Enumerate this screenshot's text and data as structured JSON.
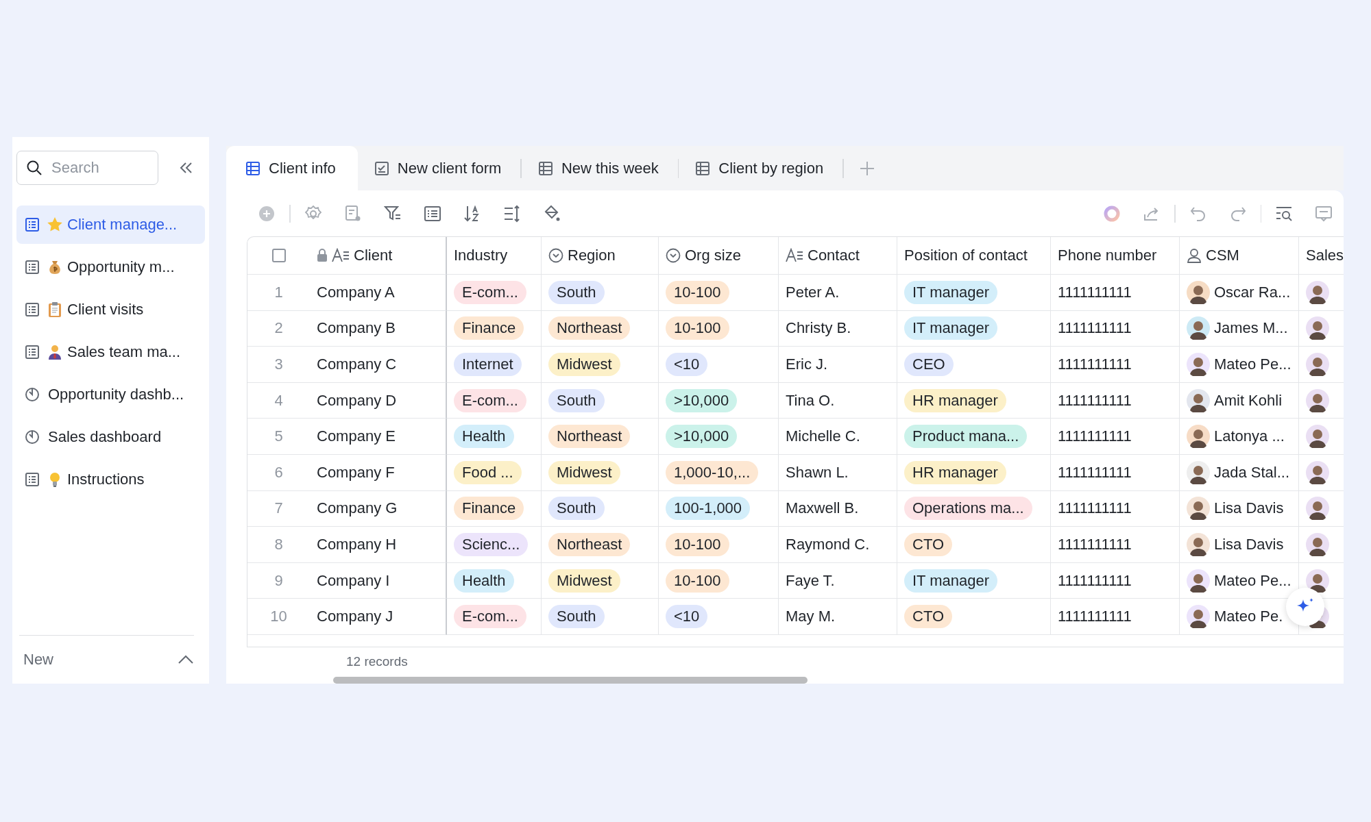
{
  "sidebar": {
    "search": {
      "placeholder": "Search"
    },
    "items": [
      {
        "label": "Client manage...",
        "kind": "table",
        "selected": true
      },
      {
        "label": "Opportunity m...",
        "kind": "table",
        "selected": false
      },
      {
        "label": "Client visits",
        "kind": "table",
        "selected": false
      },
      {
        "label": "Sales team ma...",
        "kind": "table",
        "selected": false
      },
      {
        "label": "Opportunity dashb...",
        "kind": "dashboard",
        "selected": false
      },
      {
        "label": "Sales dashboard",
        "kind": "dashboard",
        "selected": false
      },
      {
        "label": "Instructions",
        "kind": "table",
        "selected": false
      }
    ],
    "footer": {
      "label": "New",
      "expanded": true
    }
  },
  "tabs": [
    {
      "label": "Client info",
      "kind": "grid",
      "selected": true
    },
    {
      "label": "New client form",
      "kind": "form",
      "selected": false
    },
    {
      "label": "New this week",
      "kind": "grid",
      "selected": false
    },
    {
      "label": "Client by region",
      "kind": "grid",
      "selected": false
    }
  ],
  "table": {
    "select_all": {
      "checked": false
    },
    "columns": [
      {
        "label": "Client",
        "kind": "text",
        "locked": true
      },
      {
        "label": "Industry",
        "kind": "plain",
        "locked": false
      },
      {
        "label": "Region",
        "kind": "select",
        "locked": false
      },
      {
        "label": "Org size",
        "kind": "select",
        "locked": false
      },
      {
        "label": "Contact",
        "kind": "text",
        "locked": false
      },
      {
        "label": "Position of contact",
        "kind": "plain",
        "locked": false
      },
      {
        "label": "Phone number",
        "kind": "plain",
        "locked": false
      },
      {
        "label": "CSM",
        "kind": "person",
        "locked": false
      },
      {
        "label": "Sales",
        "kind": "plain",
        "locked": false
      }
    ],
    "rows": [
      {
        "number": "1",
        "client": "Company A",
        "industry": {
          "text": "E-com...",
          "color": "#fde3e6"
        },
        "region": {
          "text": "South",
          "color": "#e0e7fc"
        },
        "org_size": {
          "text": "10-100",
          "color": "#fde7d2"
        },
        "contact": "Peter A.",
        "position": {
          "text": "IT manager",
          "color": "#d3eefa"
        },
        "phone": "1111111111",
        "csm": "Oscar Ra...",
        "sales_avatar": true
      },
      {
        "number": "2",
        "client": "Company B",
        "industry": {
          "text": "Finance",
          "color": "#fde7d2"
        },
        "region": {
          "text": "Northeast",
          "color": "#fde7d2"
        },
        "org_size": {
          "text": "10-100",
          "color": "#fde7d2"
        },
        "contact": "Christy B.",
        "position": {
          "text": "IT manager",
          "color": "#d3eefa"
        },
        "phone": "1111111111",
        "csm": "James M...",
        "sales_avatar": true
      },
      {
        "number": "3",
        "client": "Company C",
        "industry": {
          "text": "Internet",
          "color": "#e0e7fc"
        },
        "region": {
          "text": "Midwest",
          "color": "#fcf0c8"
        },
        "org_size": {
          "text": "<10",
          "color": "#e0e7fc"
        },
        "contact": "Eric J.",
        "position": {
          "text": "CEO",
          "color": "#e0e7fc"
        },
        "phone": "1111111111",
        "csm": "Mateo Pe...",
        "sales_avatar": true
      },
      {
        "number": "4",
        "client": "Company D",
        "industry": {
          "text": "E-com...",
          "color": "#fde3e6"
        },
        "region": {
          "text": "South",
          "color": "#e0e7fc"
        },
        "org_size": {
          "text": ">10,000",
          "color": "#cbf2ea"
        },
        "contact": "Tina O.",
        "position": {
          "text": "HR manager",
          "color": "#fcf0c8"
        },
        "phone": "1111111111",
        "csm": "Amit Kohli",
        "sales_avatar": true
      },
      {
        "number": "5",
        "client": "Company E",
        "industry": {
          "text": "Health",
          "color": "#d3eefa"
        },
        "region": {
          "text": "Northeast",
          "color": "#fde7d2"
        },
        "org_size": {
          "text": ">10,000",
          "color": "#cbf2ea"
        },
        "contact": "Michelle C.",
        "position": {
          "text": "Product mana...",
          "color": "#cbf2ea"
        },
        "phone": "1111111111",
        "csm": "Latonya ...",
        "sales_avatar": true
      },
      {
        "number": "6",
        "client": "Company F",
        "industry": {
          "text": "Food ...",
          "color": "#fcf0c8"
        },
        "region": {
          "text": "Midwest",
          "color": "#fcf0c8"
        },
        "org_size": {
          "text": "1,000-10,...",
          "color": "#fde7d2"
        },
        "contact": "Shawn L.",
        "position": {
          "text": "HR manager",
          "color": "#fcf0c8"
        },
        "phone": "1111111111",
        "csm": "Jada Stal...",
        "sales_avatar": true
      },
      {
        "number": "7",
        "client": "Company G",
        "industry": {
          "text": "Finance",
          "color": "#fde7d2"
        },
        "region": {
          "text": "South",
          "color": "#e0e7fc"
        },
        "org_size": {
          "text": "100-1,000",
          "color": "#d3eefa"
        },
        "contact": "Maxwell B.",
        "position": {
          "text": "Operations ma...",
          "color": "#fde3e6"
        },
        "phone": "1111111111",
        "csm": "Lisa Davis",
        "sales_avatar": true
      },
      {
        "number": "8",
        "client": "Company H",
        "industry": {
          "text": "Scienc...",
          "color": "#ece4fb"
        },
        "region": {
          "text": "Northeast",
          "color": "#fde7d2"
        },
        "org_size": {
          "text": "10-100",
          "color": "#fde7d2"
        },
        "contact": "Raymond C.",
        "position": {
          "text": "CTO",
          "color": "#fde7d2"
        },
        "phone": "1111111111",
        "csm": "Lisa Davis",
        "sales_avatar": true
      },
      {
        "number": "9",
        "client": "Company I",
        "industry": {
          "text": "Health",
          "color": "#d3eefa"
        },
        "region": {
          "text": "Midwest",
          "color": "#fcf0c8"
        },
        "org_size": {
          "text": "10-100",
          "color": "#fde7d2"
        },
        "contact": "Faye T.",
        "position": {
          "text": "IT manager",
          "color": "#d3eefa"
        },
        "phone": "1111111111",
        "csm": "Mateo Pe...",
        "sales_avatar": true
      },
      {
        "number": "10",
        "client": "Company J",
        "industry": {
          "text": "E-com...",
          "color": "#fde3e6"
        },
        "region": {
          "text": "South",
          "color": "#e0e7fc"
        },
        "org_size": {
          "text": "<10",
          "color": "#e0e7fc"
        },
        "contact": "May M.",
        "position": {
          "text": "CTO",
          "color": "#fde7d2"
        },
        "phone": "1111111111",
        "csm": "Mateo Pe.",
        "sales_avatar": true
      }
    ],
    "record_count": "12 records"
  }
}
